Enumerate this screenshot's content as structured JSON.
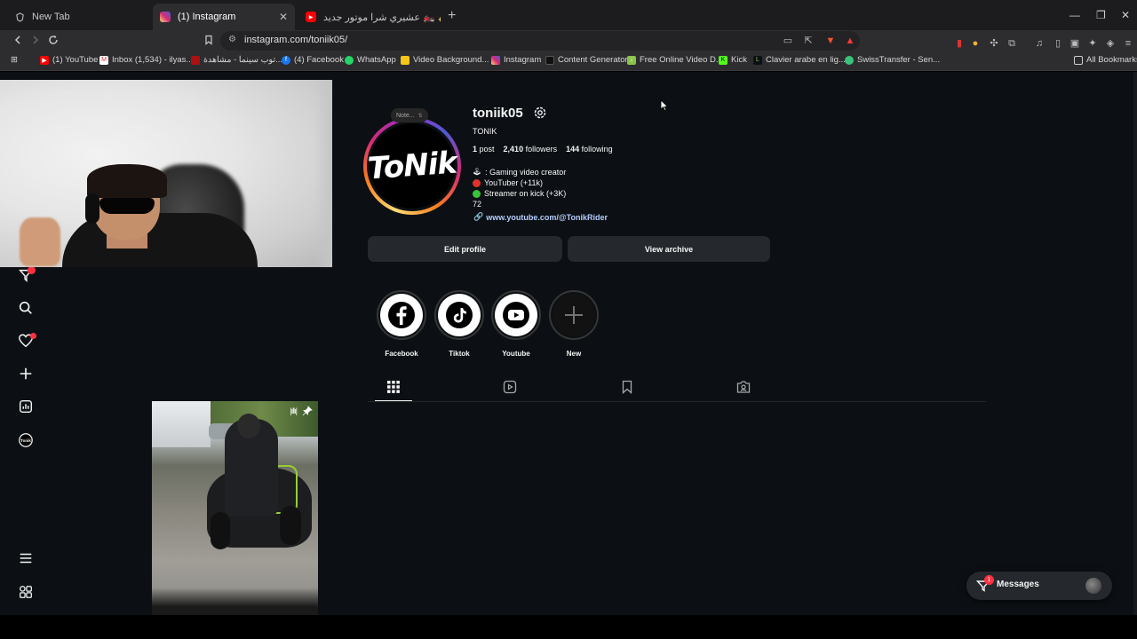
{
  "browser": {
    "tabs": [
      {
        "title": "New Tab",
        "active": false
      },
      {
        "title": "(1) Instagram",
        "active": true
      },
      {
        "title": "عشيري شرا موتور جديد 🏍️ ✨ - YouTube",
        "active": false
      }
    ],
    "url": "instagram.com/toniik05/",
    "bookmarks": [
      "(1) YouTube",
      "Inbox (1,534) - ilyas...",
      "توب سينما - مشاهدة...",
      "(4) Facebook",
      "WhatsApp",
      "Video Background...",
      "Instagram",
      "Content Generator",
      "Free Online Video D...",
      "Kick",
      "Clavier arabe en lig...",
      "SwissTransfer - Sen...",
      "All Bookmarks"
    ]
  },
  "profile": {
    "note_placeholder": "Note...",
    "avatar_text": "ToNik",
    "username": "toniik05",
    "full_name": "TONIK",
    "posts_count": "1",
    "posts_label": "post",
    "followers_count": "2,410",
    "followers_label": "followers",
    "following_count": "144",
    "following_label": "following",
    "bio": [
      {
        "icon": "joystick",
        "text": ": Gaming video creator"
      },
      {
        "icon": "red-circle",
        "text": "YouTuber (+11k)"
      },
      {
        "icon": "green-circle",
        "text": "Streamer on kick (+3K)"
      },
      {
        "icon": "",
        "text": "72"
      }
    ],
    "link": "www.youtube.com/@TonikRider",
    "edit_profile_label": "Edit profile",
    "view_archive_label": "View archive"
  },
  "highlights": [
    {
      "label": "Facebook",
      "icon": "facebook-icon"
    },
    {
      "label": "Tiktok",
      "icon": "tiktok-icon"
    },
    {
      "label": "Youtube",
      "icon": "youtube-icon"
    },
    {
      "label": "New",
      "icon": "plus-icon"
    }
  ],
  "messages": {
    "label": "Messages",
    "badge": "1"
  },
  "notifications": {
    "activity_badge": "1"
  },
  "colors": {
    "accent_link": "#b5cdff",
    "badge_red": "#ff3040",
    "background": "#0c1014"
  }
}
